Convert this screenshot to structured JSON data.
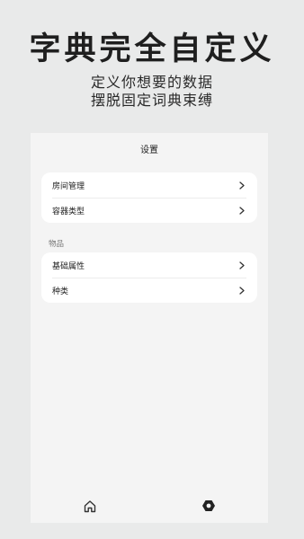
{
  "promo": {
    "title": "字典完全自定义",
    "subtitle_line1": "定义你想要的数据",
    "subtitle_line2": "摆脱固定词典束缚"
  },
  "screen": {
    "title": "设置",
    "group1": {
      "items": [
        {
          "label": "房间管理",
          "icon": "chevron-right-icon"
        },
        {
          "label": "容器类型",
          "icon": "chevron-right-icon"
        }
      ]
    },
    "group2": {
      "header": "物品",
      "items": [
        {
          "label": "基础属性",
          "icon": "chevron-right-icon"
        },
        {
          "label": "种类",
          "icon": "chevron-right-icon"
        }
      ]
    },
    "tabbar": {
      "tabs": [
        {
          "icon": "home-icon",
          "selected": false
        },
        {
          "icon": "settings-icon",
          "selected": true
        }
      ]
    }
  },
  "colors": {
    "background": "#e9eaea",
    "screen_background": "#f4f4f4",
    "card": "#ffffff",
    "text": "#222222",
    "section_text": "#777777"
  }
}
